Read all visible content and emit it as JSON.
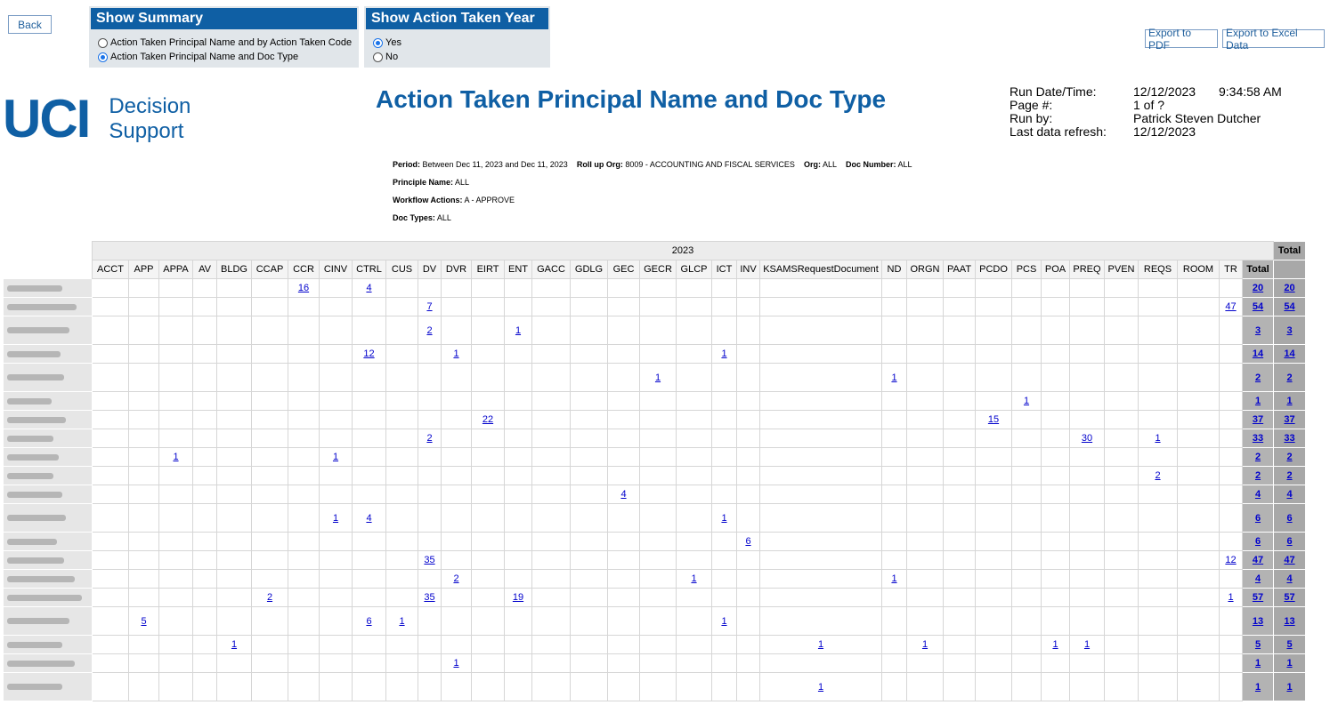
{
  "back_label": "Back",
  "summary_panel": {
    "title": "Show Summary",
    "options": [
      {
        "label": "Action Taken Principal Name and by Action Taken Code",
        "selected": false
      },
      {
        "label": "Action Taken Principal Name and Doc Type",
        "selected": true
      }
    ]
  },
  "year_panel": {
    "title": "Show Action Taken Year",
    "options": [
      {
        "label": "Yes",
        "selected": true
      },
      {
        "label": "No",
        "selected": false
      }
    ]
  },
  "export": {
    "pdf": "Export to PDF",
    "excel": "Export to Excel Data"
  },
  "logo": {
    "mark": "UCI",
    "line1": "Decision",
    "line2": "Support",
    "color": "#0f5fa4"
  },
  "report_title": "Action Taken Principal Name and Doc Type",
  "run_info": {
    "date_label": "Run Date/Time:",
    "date": "12/12/2023",
    "time": "9:34:58 AM",
    "page_label": "Page #:",
    "page": "1 of ?",
    "runby_label": "Run by:",
    "runby": "Patrick Steven Dutcher",
    "refresh_label": "Last data refresh:",
    "refresh": "12/12/2023"
  },
  "params": {
    "period_label": "Period:",
    "period": "Between Dec 11, 2023 and Dec 11, 2023",
    "rollup_label": "Roll up Org:",
    "rollup": "8009 - ACCOUNTING AND FISCAL SERVICES",
    "org_label": "Org:",
    "org": "ALL",
    "docnum_label": "Doc Number:",
    "docnum": "ALL",
    "principle_label": "Principle Name:",
    "principle": "ALL",
    "workflow_label": "Workflow Actions:",
    "workflow": "A - APPROVE",
    "doctypes_label": "Doc Types:",
    "doctypes": "ALL"
  },
  "table": {
    "year": "2023",
    "grand_total_label": "Total",
    "columns": [
      "ACCT",
      "APP",
      "APPA",
      "AV",
      "BLDG",
      "CCAP",
      "CCR",
      "CINV",
      "CTRL",
      "CUS",
      "DV",
      "DVR",
      "EIRT",
      "ENT",
      "GACC",
      "GDLG",
      "GEC",
      "GECR",
      "GLCP",
      "ICT",
      "INV",
      "KSAMSRequestDocument",
      "ND",
      "ORGN",
      "PAAT",
      "PCDO",
      "PCS",
      "POA",
      "PREQ",
      "PVEN",
      "REQS",
      "ROOM",
      "TR",
      "Total"
    ],
    "rows": [
      {
        "tall": false,
        "cells": {
          "CCR": "16",
          "CTRL": "4"
        },
        "total": "20",
        "grand": "20"
      },
      {
        "tall": false,
        "cells": {
          "DV": "7",
          "TR": "47"
        },
        "total": "54",
        "grand": "54"
      },
      {
        "tall": true,
        "cells": {
          "DV": "2",
          "ENT": "1"
        },
        "total": "3",
        "grand": "3"
      },
      {
        "tall": false,
        "cells": {
          "CTRL": "12",
          "DVR": "1",
          "ICT": "1"
        },
        "total": "14",
        "grand": "14"
      },
      {
        "tall": true,
        "cells": {
          "GECR": "1",
          "ND": "1"
        },
        "total": "2",
        "grand": "2"
      },
      {
        "tall": false,
        "cells": {
          "PCS": "1"
        },
        "total": "1",
        "grand": "1"
      },
      {
        "tall": false,
        "cells": {
          "EIRT": "22",
          "PCDO": "15"
        },
        "total": "37",
        "grand": "37"
      },
      {
        "tall": false,
        "cells": {
          "DV": "2",
          "PREQ": "30",
          "REQS": "1"
        },
        "total": "33",
        "grand": "33"
      },
      {
        "tall": false,
        "cells": {
          "APPA": "1",
          "CINV": "1"
        },
        "total": "2",
        "grand": "2"
      },
      {
        "tall": false,
        "cells": {
          "REQS": "2"
        },
        "total": "2",
        "grand": "2"
      },
      {
        "tall": false,
        "cells": {
          "GEC": "4"
        },
        "total": "4",
        "grand": "4"
      },
      {
        "tall": true,
        "cells": {
          "CINV": "1",
          "CTRL": "4",
          "ICT": "1"
        },
        "total": "6",
        "grand": "6"
      },
      {
        "tall": false,
        "cells": {
          "INV": "6"
        },
        "total": "6",
        "grand": "6"
      },
      {
        "tall": false,
        "cells": {
          "DV": "35",
          "TR": "12"
        },
        "total": "47",
        "grand": "47"
      },
      {
        "tall": false,
        "cells": {
          "DVR": "2",
          "GLCP": "1",
          "ND": "1"
        },
        "total": "4",
        "grand": "4"
      },
      {
        "tall": false,
        "cells": {
          "CCAP": "2",
          "DV": "35",
          "ENT": "19",
          "TR": "1"
        },
        "total": "57",
        "grand": "57"
      },
      {
        "tall": true,
        "cells": {
          "APP": "5",
          "CTRL": "6",
          "CUS": "1",
          "ICT": "1"
        },
        "total": "13",
        "grand": "13"
      },
      {
        "tall": false,
        "cells": {
          "BLDG": "1",
          "KSAMSRequestDocument": "1",
          "ORGN": "1",
          "POA": "1",
          "PREQ": "1"
        },
        "total": "5",
        "grand": "5"
      },
      {
        "tall": false,
        "cells": {
          "DVR": "1"
        },
        "total": "1",
        "grand": "1"
      },
      {
        "tall": true,
        "cells": {
          "KSAMSRequestDocument": "1"
        },
        "total": "1",
        "grand": "1"
      }
    ]
  }
}
